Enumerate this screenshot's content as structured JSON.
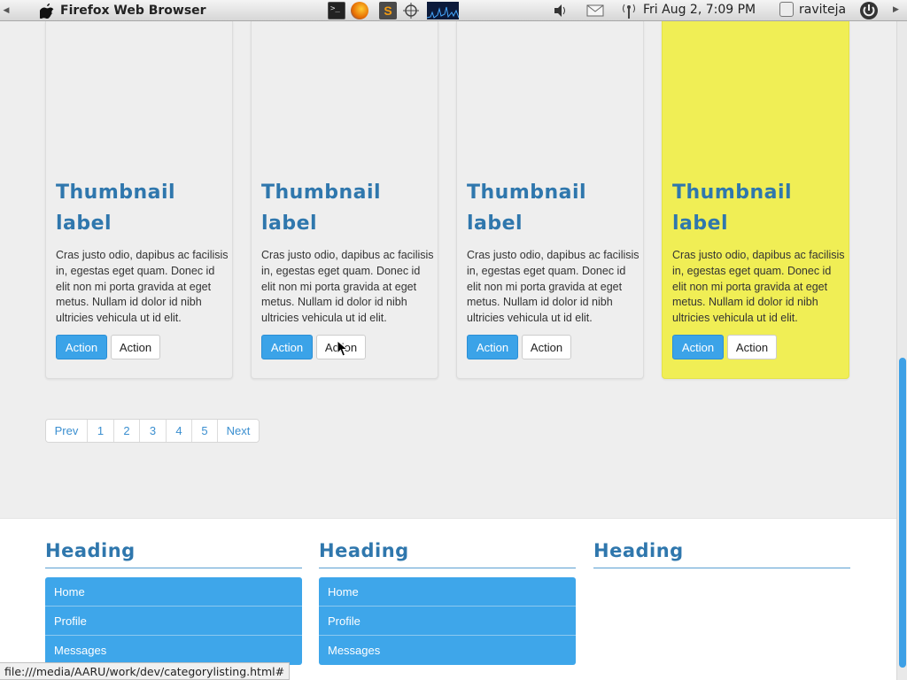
{
  "panel": {
    "app_title": "Firefox Web Browser",
    "clock": "Fri Aug  2,  7:09 PM",
    "username": "raviteja",
    "icons": [
      "terminal-icon",
      "firefox-icon",
      "sublime-icon",
      "crosshair-icon",
      "system-monitor-icon",
      "volume-icon",
      "mail-icon",
      "network-icon",
      "user-checkbox-icon",
      "power-icon"
    ]
  },
  "thumbnails": [
    {
      "title": "Thumbnail label",
      "description": "Cras justo odio, dapibus ac facilisis in, egestas eget quam. Donec id elit non mi porta gravida at eget metus. Nullam id dolor id nibh ultricies vehicula ut id elit.",
      "primary_label": "Action",
      "secondary_label": "Action",
      "highlighted": false
    },
    {
      "title": "Thumbnail label",
      "description": "Cras justo odio, dapibus ac facilisis in, egestas eget quam. Donec id elit non mi porta gravida at eget metus. Nullam id dolor id nibh ultricies vehicula ut id elit.",
      "primary_label": "Action",
      "secondary_label": "Action",
      "highlighted": false
    },
    {
      "title": "Thumbnail label",
      "description": "Cras justo odio, dapibus ac facilisis in, egestas eget quam. Donec id elit non mi porta gravida at eget metus. Nullam id dolor id nibh ultricies vehicula ut id elit.",
      "primary_label": "Action",
      "secondary_label": "Action",
      "highlighted": false
    },
    {
      "title": "Thumbnail label",
      "description": "Cras justo odio, dapibus ac facilisis in, egestas eget quam. Donec id elit non mi porta gravida at eget metus. Nullam id dolor id nibh ultricies vehicula ut id elit.",
      "primary_label": "Action",
      "secondary_label": "Action",
      "highlighted": true
    }
  ],
  "pagination": [
    "Prev",
    "1",
    "2",
    "3",
    "4",
    "5",
    "Next"
  ],
  "footer": {
    "columns": [
      {
        "heading": "Heading",
        "items": [
          "Home",
          "Profile",
          "Messages"
        ]
      },
      {
        "heading": "Heading",
        "items": [
          "Home",
          "Profile",
          "Messages"
        ]
      },
      {
        "heading": "Heading",
        "items": []
      }
    ]
  },
  "status_url": "file:///media/AARU/work/dev/categorylisting.html#",
  "colors": {
    "accent": "#3ea6ea",
    "heading": "#2f77ad",
    "highlight": "#f0ee55",
    "page_bg": "#eeeeee"
  }
}
